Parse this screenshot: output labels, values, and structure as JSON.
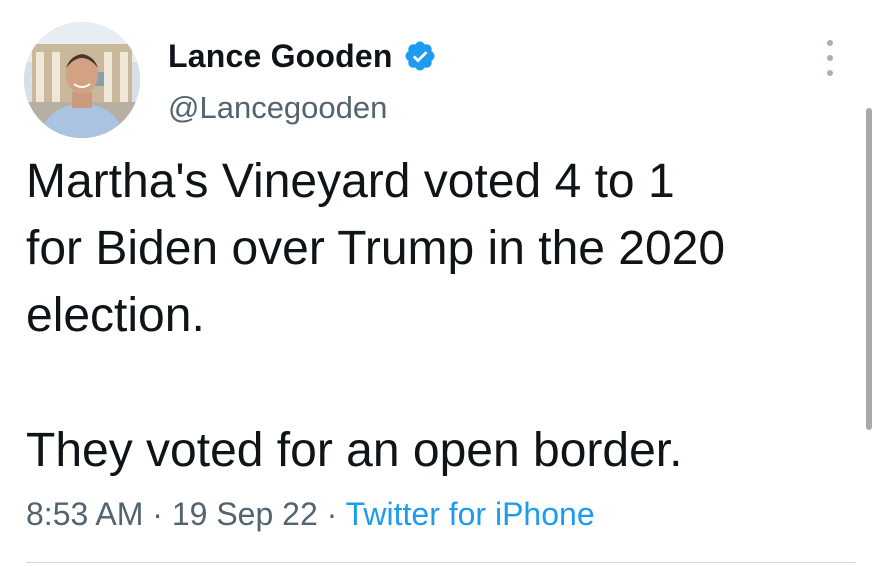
{
  "author": {
    "display_name": "Lance Gooden",
    "handle": "@Lancegooden",
    "verified": true,
    "verified_badge_icon": "verified-badge-icon",
    "avatar_icon": "profile-photo"
  },
  "tweet": {
    "text_lines": [
      "Martha's Vineyard voted 4 to 1",
      "for Biden over Trump in the 2020",
      "election.",
      "They voted for an open border."
    ],
    "time": "8:53 AM",
    "separator": " · ",
    "date": "19 Sep 22",
    "source": "Twitter for iPhone"
  },
  "menu": {
    "more_icon": "more-options-icon"
  },
  "colors": {
    "accent": "#1d9bf0",
    "text_primary": "#0f1419",
    "text_secondary": "#536471",
    "divider": "#cfd9de"
  }
}
